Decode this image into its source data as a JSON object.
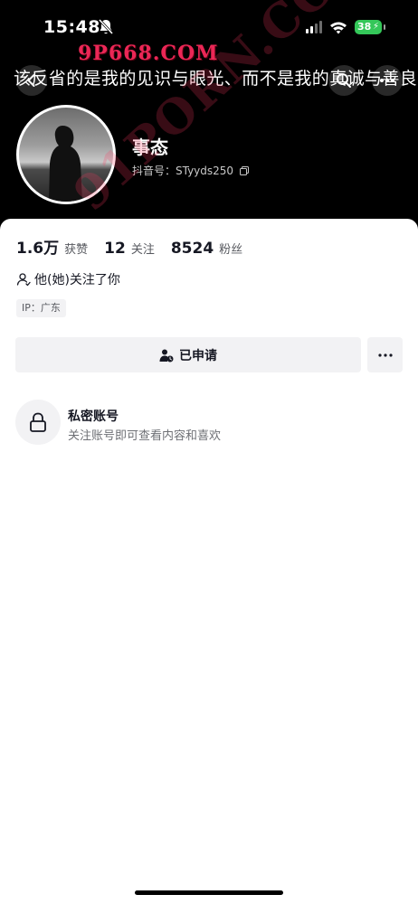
{
  "status_bar": {
    "time": "15:48",
    "battery": "38",
    "icons": [
      "bell-muted-icon",
      "signal-icon",
      "wifi-icon",
      "battery-icon"
    ]
  },
  "watermarks": {
    "top": "9P668.COM",
    "diagonal": "91PORN.COM"
  },
  "header": {
    "signature": "该反省的是我的见识与眼光、而不是我的真诚与善良",
    "nav_icons": [
      "chevron-left-icon",
      "search-icon",
      "more-icon"
    ]
  },
  "profile": {
    "nickname": "事态",
    "douyin_id": "抖音号：STyyds250"
  },
  "stats": [
    {
      "num": "1.6万",
      "label": "获赞"
    },
    {
      "num": "12",
      "label": "关注"
    },
    {
      "num": "8524",
      "label": "粉丝"
    }
  ],
  "relation": {
    "follows_you": "他(她)关注了你"
  },
  "ip": "IP：广东",
  "actions": {
    "applied_label": "已申请"
  },
  "private": {
    "title": "私密账号",
    "subtitle": "关注账号即可查看内容和喜欢"
  },
  "colors": {
    "cover_bg": "#000000",
    "button_bg": "#f2f2f4",
    "battery": "#34c759",
    "watermark": "#ff2b5e"
  }
}
